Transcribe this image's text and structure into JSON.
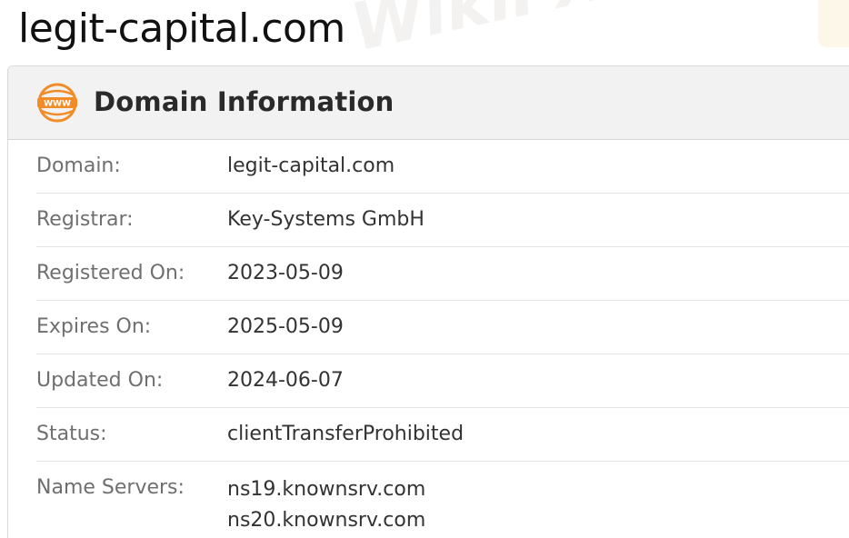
{
  "site": {
    "title": "legit-capital.com"
  },
  "card": {
    "icon": "www-globe-icon",
    "title": "Domain Information",
    "accent_color": "#f28c28"
  },
  "rows": [
    {
      "label": "Domain:",
      "value": "legit-capital.com"
    },
    {
      "label": "Registrar:",
      "value": "Key-Systems GmbH"
    },
    {
      "label": "Registered On:",
      "value": "2023-05-09"
    },
    {
      "label": "Expires On:",
      "value": "2025-05-09"
    },
    {
      "label": "Updated On:",
      "value": "2024-06-07"
    },
    {
      "label": "Status:",
      "value": "clientTransferProhibited"
    },
    {
      "label": "Name Servers:",
      "values": [
        "ns19.knownsrv.com",
        "ns20.knownsrv.com"
      ]
    }
  ],
  "watermark": {
    "text": "WikiFX"
  }
}
